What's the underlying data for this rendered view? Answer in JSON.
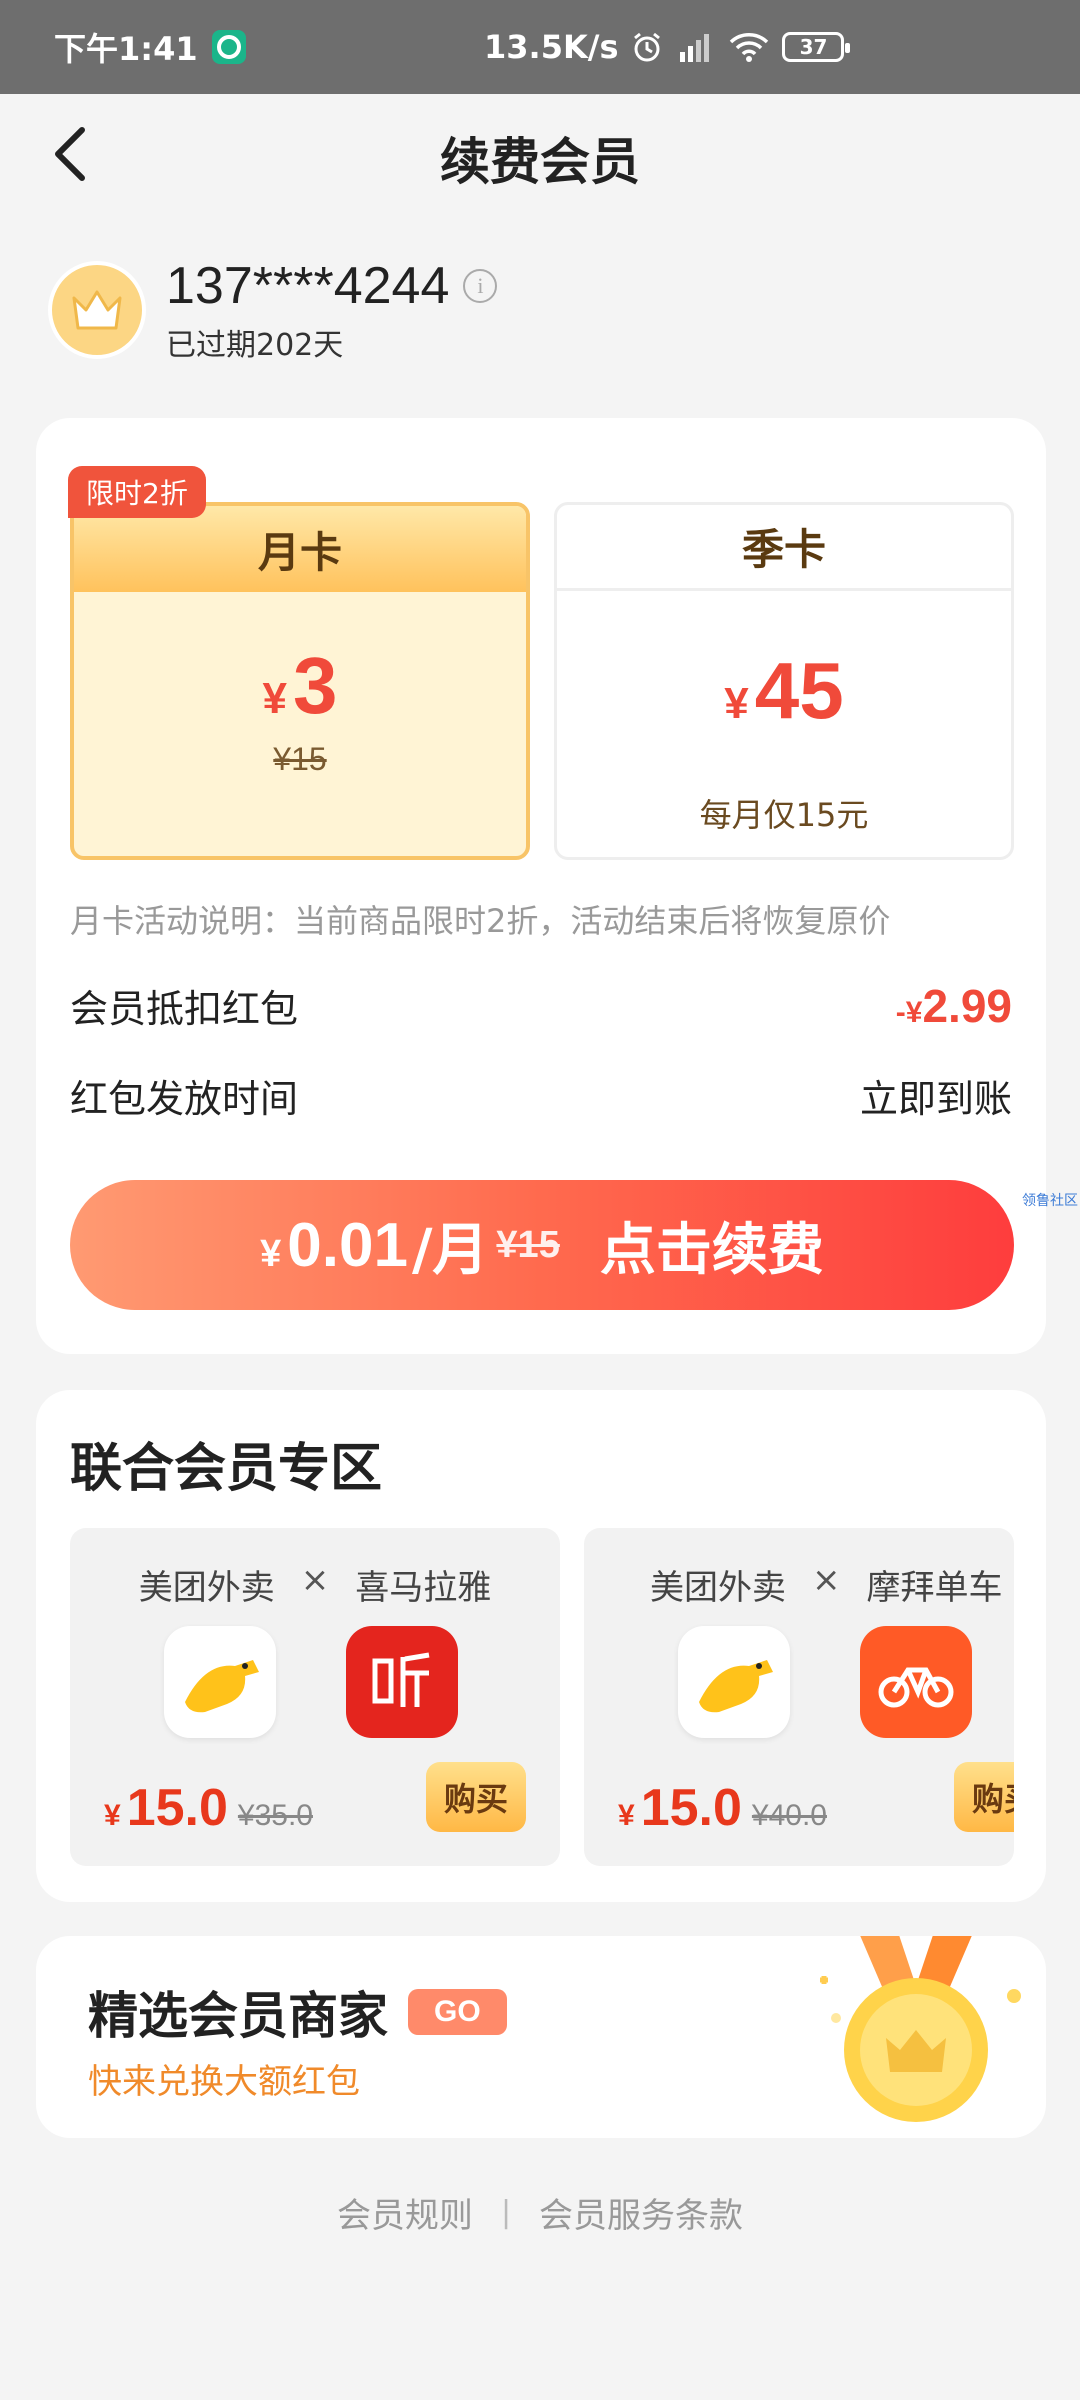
{
  "status_bar": {
    "time": "下午1:41",
    "net_speed": "13.5K/s",
    "battery": "37"
  },
  "header": {
    "title": "续费会员"
  },
  "user": {
    "phone": "137****4244",
    "expired": "已过期202天"
  },
  "plans": {
    "tag": "限时2折",
    "month": {
      "label": "月卡",
      "price": "3",
      "original": "¥15"
    },
    "season": {
      "label": "季卡",
      "price": "45",
      "note": "每月仅15元"
    },
    "currency": "¥"
  },
  "promo_note": "月卡活动说明：当前商品限时2折，活动结束后将恢复原价",
  "discount": {
    "label": "会员抵扣红包",
    "sign": "-",
    "value": "2.99"
  },
  "delivery": {
    "label": "红包发放时间",
    "value": "立即到账"
  },
  "renew_button": {
    "price": "0.01",
    "unit": "/月",
    "original": "¥15",
    "text": "点击续费"
  },
  "side_link": "领鲁社区",
  "joint": {
    "title": "联合会员专区",
    "combos": [
      {
        "left": "美团外卖",
        "cross": "×",
        "right": "喜马拉雅",
        "price": "15.0",
        "original": "¥35.0",
        "buy": "购买"
      },
      {
        "left": "美团外卖",
        "cross": "×",
        "right": "摩拜单车",
        "price": "15.0",
        "original": "¥40.0",
        "buy": "购买"
      }
    ]
  },
  "merchant": {
    "title": "精选会员商家",
    "go": "GO",
    "subtitle": "快来兑换大额红包"
  },
  "footer": {
    "rules": "会员规则",
    "separator": "|",
    "terms": "会员服务条款"
  },
  "colors": {
    "accent_red": "#f04a3a",
    "gold": "#ffc25c",
    "orange_text": "#f08a2a"
  }
}
